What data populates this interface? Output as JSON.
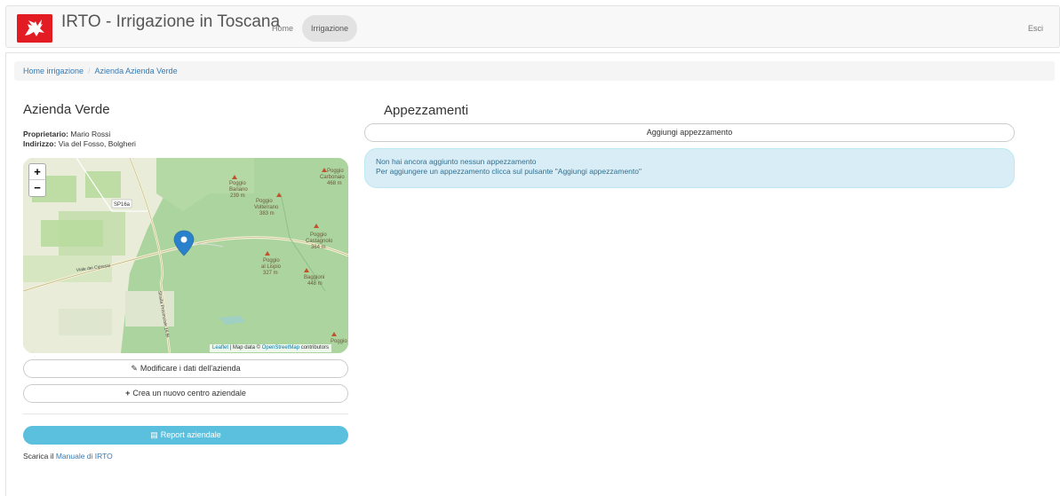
{
  "navbar": {
    "brand": "IRTO - Irrigazione in Toscana",
    "home": "Home",
    "irrigazione": "Irrigazione",
    "esci": "Esci",
    "logo_icon": "tuscany-pegasus-logo-icon"
  },
  "breadcrumb": {
    "home": "Home irrigazione",
    "separator": "/",
    "current": "Azienda Azienda Verde"
  },
  "azienda": {
    "title": "Azienda Verde",
    "owner_label": "Proprietario:",
    "owner_value": "Mario Rossi",
    "address_label": "Indirizzo:",
    "address_value": "Via del Fosso, Bolgheri"
  },
  "map": {
    "zoom_in": "+",
    "zoom_out": "−",
    "attribution_leaflet": "Leaflet",
    "attribution_sep": " | Map data © ",
    "attribution_osm": "OpenStreetMap",
    "attribution_tail": " contributors",
    "labels": {
      "poggio_bariano": [
        "Poggio",
        "Bariano",
        "239 m"
      ],
      "poggio_carbonaio": [
        "Poggio",
        "Carbonaio",
        "468 m"
      ],
      "poggio_volterrano": [
        "Poggio",
        "Volterrano",
        "383 m"
      ],
      "poggio_castagnolo": [
        "Poggio",
        "Castagnolo",
        "364 m"
      ],
      "poggio_lispio": [
        "Poggio",
        "al Lispio",
        "327 m"
      ],
      "baggioni": [
        "Baggioni",
        "448 m"
      ],
      "sp16a": "SP16a",
      "viale": "Viale dei Cipressi",
      "strada": "Strada Provinciale 16 Bi",
      "poggio_bottom": "Poggio"
    },
    "pin_color": "#2a81cb"
  },
  "actions": {
    "modify": "Modificare i dati dell'azienda",
    "new_center": "Crea un nuovo centro aziendale",
    "report": "Report aziendale",
    "scarica_prefix": "Scarica il ",
    "manual_link": "Manuale di IRTO"
  },
  "appezzamenti": {
    "title": "Appezzamenti",
    "add_button": "Aggiungi appezzamento",
    "alert_line1": "Non hai ancora aggiunto nessun appezzamento",
    "alert_line2": "Per aggiungere un appezzamento clicca sul pulsante \"Aggiungi appezzamento\""
  },
  "colors": {
    "accent_link": "#337ab7",
    "report_button": "#5bc0de",
    "alert_bg": "#d9edf7",
    "alert_text": "#31708f",
    "logo_red": "#e31b23"
  }
}
